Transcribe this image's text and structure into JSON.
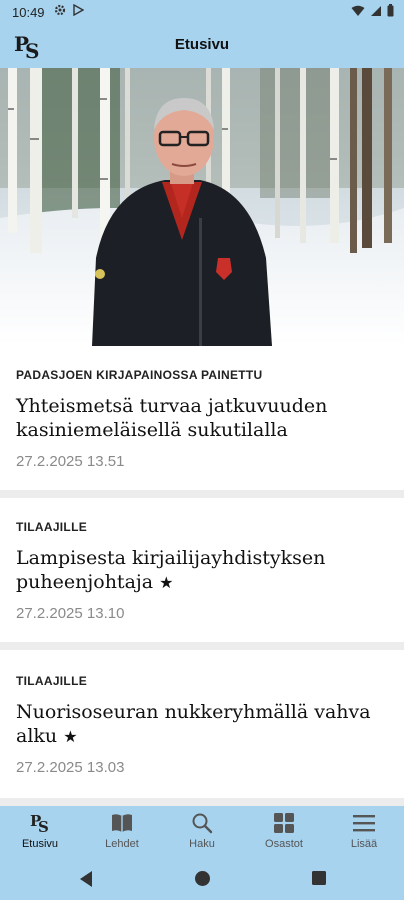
{
  "status_bar": {
    "time": "10:49",
    "left_icons": [
      "gear-icon",
      "play-store-icon"
    ],
    "right_icons": [
      "wifi-icon",
      "signal-icon",
      "battery-icon"
    ]
  },
  "app_bar": {
    "logo_text": "PS",
    "title": "Etusivu"
  },
  "hero_image": "man-in-snowy-forest-photo",
  "articles": [
    {
      "kicker": "PADASJOEN KIRJAPAINOSSA PAINETTU",
      "headline": "Yhteismetsä turvaa jatkuvuuden kasiniemeläisellä sukutilalla",
      "date": "27.2.2025 13.51",
      "premium": false
    },
    {
      "kicker": "TILAAJILLE",
      "headline": "Lampisesta kirjailijayhdistyksen puheenjohtaja",
      "date": "27.2.2025 13.10",
      "premium": true
    },
    {
      "kicker": "TILAAJILLE",
      "headline": "Nuorisoseuran nukkeryhmällä vahva alku",
      "date": "27.2.2025 13.03",
      "premium": true
    }
  ],
  "premium_star": "★",
  "bottom_nav": [
    {
      "label": "Etusivu",
      "icon": "ps-logo-icon",
      "active": true
    },
    {
      "label": "Lehdet",
      "icon": "book-icon",
      "active": false
    },
    {
      "label": "Haku",
      "icon": "search-icon",
      "active": false
    },
    {
      "label": "Osastot",
      "icon": "grid-icon",
      "active": false
    },
    {
      "label": "Lisää",
      "icon": "menu-icon",
      "active": false
    }
  ],
  "system_nav": [
    "back-icon",
    "home-icon",
    "recents-icon"
  ],
  "colors": {
    "bar_background": "#a7d3ef",
    "card_background": "#ffffff",
    "page_background": "#ececec",
    "date_text": "#8a8a8a"
  }
}
